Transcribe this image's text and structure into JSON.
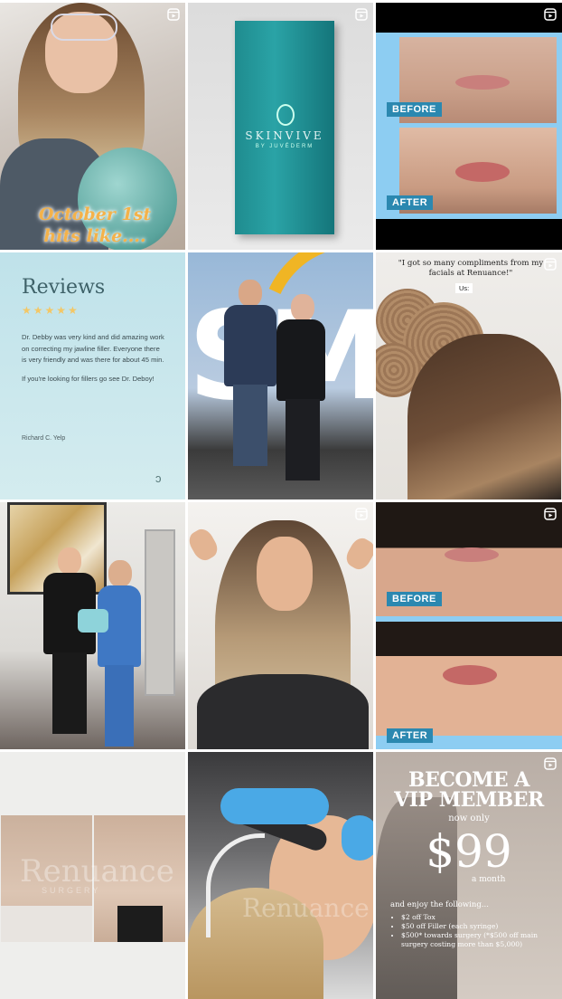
{
  "tiles": {
    "t1": {
      "caption_line1": "October 1st",
      "caption_line2": "hits like...."
    },
    "t2": {
      "brand": "SKINVIVE",
      "brand_sub": "BY JUVÉDERM"
    },
    "t3": {
      "before": "BEFORE",
      "after": "AFTER"
    },
    "t4": {
      "title": "Reviews",
      "stars": "★★★★★",
      "p1": "Dr. Debby was very kind and did amazing work on correcting my jawline filler. Everyone there is very friendly and was there for about 45 min.",
      "p2": "If you're looking for fillers go see Dr. Deboy!",
      "author": "Richard C. Yelp"
    },
    "t6": {
      "quote": "\"I got so many compliments from my facials at Renuance!\"",
      "us": "Us:"
    },
    "t9": {
      "before": "BEFORE",
      "after": "AFTER"
    },
    "t10": {
      "watermark": "Renuance",
      "watermark_sub": "SURGERY"
    },
    "t11": {
      "watermark": "Renuance"
    },
    "t12": {
      "title_line1": "BECOME A",
      "title_line2": "VIP MEMBER",
      "now": "now only",
      "price": "$99",
      "per": "a month",
      "enjoy": "and enjoy the following...",
      "items": [
        "$2 off Tox",
        "$50 off Filler (each syringe)",
        "$500* towards surgery (*$500 off main surgery costing more than $5,000)"
      ]
    }
  },
  "colors": {
    "reel_icon": "#ffffff",
    "label_blue": "#2b88b0",
    "panel_blue": "#8dcdf2"
  },
  "icons": {
    "reel": "reel-icon"
  }
}
